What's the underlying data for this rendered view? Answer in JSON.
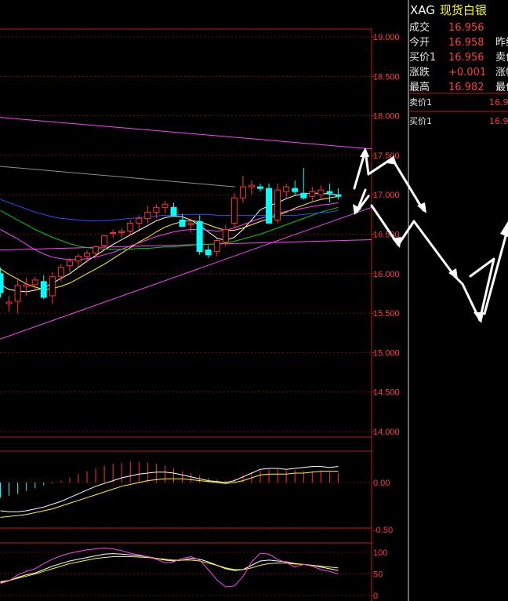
{
  "quote_panel": {
    "symbol": "XAG",
    "name": "现货白银",
    "rows": [
      {
        "label": "成交",
        "value": "16.956",
        "label2": ""
      },
      {
        "label": "今开",
        "value": "16.958",
        "label2": "昨结"
      },
      {
        "label": "买价1",
        "value": "16.956",
        "label2": "卖价"
      },
      {
        "label": "涨跌",
        "value": "+0.001",
        "label2": "涨幅"
      },
      {
        "label": "最高",
        "value": "16.982",
        "label2": "最低"
      }
    ],
    "orderbook": [
      {
        "label": "卖价1",
        "value": "16.9"
      },
      {
        "label": "买价1",
        "value": "16.9"
      }
    ]
  },
  "colors": {
    "up": "#ff3232",
    "down": "#00ffff",
    "frame": "#c01818",
    "grid": "#8c1010",
    "axis_text": "#ff4040",
    "ma5": "#ffffff",
    "ma10": "#ffff00",
    "ma20": "#ff40ff",
    "ma60": "#00d000",
    "ma120": "#3050ff",
    "trend": "#ff40ff",
    "forecast": "#ffffff"
  },
  "chart_data": [
    {
      "type": "candlestick",
      "ylim": [
        14.0,
        19.0
      ],
      "y_ticks": [
        "19.000",
        "18.500",
        "18.000",
        "17.500",
        "17.000",
        "16.500",
        "16.000",
        "15.500",
        "15.000",
        "14.500",
        "14.000"
      ],
      "candles": [
        {
          "o": 16.0,
          "h": 16.08,
          "l": 15.7,
          "c": 15.76
        },
        {
          "o": 15.62,
          "h": 15.72,
          "l": 15.52,
          "c": 15.64
        },
        {
          "o": 15.65,
          "h": 15.95,
          "l": 15.5,
          "c": 15.85
        },
        {
          "o": 15.84,
          "h": 15.95,
          "l": 15.72,
          "c": 15.86
        },
        {
          "o": 15.86,
          "h": 15.96,
          "l": 15.78,
          "c": 15.92
        },
        {
          "o": 15.9,
          "h": 15.98,
          "l": 15.68,
          "c": 15.7
        },
        {
          "o": 15.72,
          "h": 16.02,
          "l": 15.62,
          "c": 15.96
        },
        {
          "o": 15.96,
          "h": 16.12,
          "l": 15.9,
          "c": 16.08
        },
        {
          "o": 16.1,
          "h": 16.2,
          "l": 16.02,
          "c": 16.16
        },
        {
          "o": 16.16,
          "h": 16.25,
          "l": 16.08,
          "c": 16.22
        },
        {
          "o": 16.22,
          "h": 16.3,
          "l": 16.14,
          "c": 16.26
        },
        {
          "o": 16.26,
          "h": 16.36,
          "l": 16.2,
          "c": 16.34
        },
        {
          "o": 16.36,
          "h": 16.48,
          "l": 16.3,
          "c": 16.48
        },
        {
          "o": 16.52,
          "h": 16.56,
          "l": 16.45,
          "c": 16.52
        },
        {
          "o": 16.52,
          "h": 16.58,
          "l": 16.46,
          "c": 16.54
        },
        {
          "o": 16.54,
          "h": 16.68,
          "l": 16.48,
          "c": 16.64
        },
        {
          "o": 16.64,
          "h": 16.74,
          "l": 16.56,
          "c": 16.7
        },
        {
          "o": 16.7,
          "h": 16.86,
          "l": 16.64,
          "c": 16.78
        },
        {
          "o": 16.78,
          "h": 16.88,
          "l": 16.7,
          "c": 16.84
        },
        {
          "o": 16.84,
          "h": 16.92,
          "l": 16.76,
          "c": 16.88
        },
        {
          "o": 16.84,
          "h": 16.9,
          "l": 16.72,
          "c": 16.74
        },
        {
          "o": 16.68,
          "h": 16.76,
          "l": 16.6,
          "c": 16.6
        },
        {
          "o": 16.62,
          "h": 16.7,
          "l": 16.52,
          "c": 16.64
        },
        {
          "o": 16.66,
          "h": 16.74,
          "l": 16.24,
          "c": 16.28
        },
        {
          "o": 16.3,
          "h": 16.36,
          "l": 16.2,
          "c": 16.24
        },
        {
          "o": 16.28,
          "h": 16.44,
          "l": 16.22,
          "c": 16.42
        },
        {
          "o": 16.4,
          "h": 16.62,
          "l": 16.34,
          "c": 16.56
        },
        {
          "o": 16.64,
          "h": 17.02,
          "l": 16.58,
          "c": 16.96
        },
        {
          "o": 16.96,
          "h": 17.24,
          "l": 16.9,
          "c": 17.1
        },
        {
          "o": 17.1,
          "h": 17.18,
          "l": 17.0,
          "c": 17.12
        },
        {
          "o": 17.1,
          "h": 17.14,
          "l": 17.04,
          "c": 17.08
        },
        {
          "o": 17.08,
          "h": 17.14,
          "l": 16.64,
          "c": 16.64
        },
        {
          "o": 16.68,
          "h": 17.14,
          "l": 16.64,
          "c": 17.06
        },
        {
          "o": 17.04,
          "h": 17.14,
          "l": 16.96,
          "c": 17.1
        },
        {
          "o": 17.08,
          "h": 17.18,
          "l": 17.0,
          "c": 17.04
        },
        {
          "o": 17.02,
          "h": 17.34,
          "l": 16.94,
          "c": 16.96
        },
        {
          "o": 16.98,
          "h": 17.1,
          "l": 16.92,
          "c": 17.04
        },
        {
          "o": 17.0,
          "h": 17.12,
          "l": 16.94,
          "c": 17.06
        },
        {
          "o": 17.04,
          "h": 17.14,
          "l": 16.9,
          "c": 17.02
        },
        {
          "o": 17.0,
          "h": 17.08,
          "l": 16.94,
          "c": 16.98
        }
      ],
      "ma_series": [
        {
          "values": [
            15.86,
            15.8,
            15.78,
            15.77,
            15.79,
            15.82,
            15.88,
            15.94,
            16.0,
            16.08,
            16.16,
            16.23,
            16.3,
            16.37,
            16.43,
            16.49,
            16.55,
            16.61,
            16.67,
            16.71,
            16.73,
            16.72,
            16.68,
            16.61,
            16.53,
            16.45,
            16.42,
            16.46,
            16.56,
            16.68,
            16.81,
            16.86,
            16.9,
            16.95,
            16.99,
            17.01,
            17.02,
            17.02,
            17.01,
            17.0
          ]
        },
        {
          "values": [
            16.06,
            15.99,
            15.93,
            15.87,
            15.83,
            15.8,
            15.81,
            15.84,
            15.88,
            15.94,
            16.0,
            16.06,
            16.12,
            16.19,
            16.26,
            16.33,
            16.4,
            16.46,
            16.53,
            16.59,
            16.63,
            16.66,
            16.67,
            16.66,
            16.62,
            16.58,
            16.55,
            16.55,
            16.58,
            16.62,
            16.66,
            16.7,
            16.74,
            16.78,
            16.83,
            16.87,
            16.91,
            16.94,
            16.96,
            16.98
          ]
        },
        {
          "values": [
            16.56,
            16.5,
            16.44,
            16.37,
            16.3,
            16.25,
            16.21,
            16.19,
            16.18,
            16.18,
            16.19,
            16.21,
            16.24,
            16.27,
            16.31,
            16.35,
            16.39,
            16.43,
            16.47,
            16.5,
            16.53,
            16.55,
            16.56,
            16.56,
            16.55,
            16.54,
            16.55,
            16.58,
            16.62,
            16.66,
            16.7,
            16.73,
            16.76,
            16.79,
            16.81,
            16.83,
            16.85,
            16.87,
            16.88,
            16.9
          ]
        },
        {
          "values": [
            16.8,
            16.74,
            16.68,
            16.62,
            16.56,
            16.51,
            16.46,
            16.42,
            16.38,
            16.35,
            16.33,
            16.32,
            16.31,
            16.31,
            16.31,
            16.31,
            16.32,
            16.32,
            16.33,
            16.34,
            16.34,
            16.35,
            16.36,
            16.37,
            16.37,
            16.38,
            16.39,
            16.41,
            16.44,
            16.47,
            16.5,
            16.54,
            16.58,
            16.62,
            16.66,
            16.7,
            16.74,
            16.78,
            16.81,
            16.84
          ]
        },
        {
          "values": [
            16.94,
            16.9,
            16.86,
            16.82,
            16.78,
            16.75,
            16.72,
            16.7,
            16.69,
            16.68,
            16.67,
            16.67,
            16.67,
            16.68,
            16.69,
            16.7,
            16.71,
            16.72,
            16.73,
            16.74,
            16.74,
            16.75,
            16.75,
            16.75,
            16.75,
            16.74,
            16.74,
            16.74,
            16.74,
            16.74,
            16.74,
            16.74,
            16.74,
            16.74,
            16.74,
            16.75,
            16.76,
            16.77,
            16.78,
            16.8
          ]
        }
      ]
    },
    {
      "type": "bar",
      "ylim": [
        -0.5,
        0.5
      ],
      "y_ticks": [
        "0.00",
        "-0.50"
      ],
      "values": [
        -0.16,
        -0.14,
        -0.12,
        -0.09,
        -0.06,
        -0.03,
        -0.01,
        0.02,
        0.05,
        0.09,
        0.12,
        0.15,
        0.18,
        0.2,
        0.21,
        0.22,
        0.22,
        0.21,
        0.2,
        0.18,
        0.15,
        0.12,
        0.1,
        0.08,
        0.05,
        0.03,
        0.02,
        0.04,
        0.08,
        0.11,
        0.13,
        0.14,
        0.14,
        0.13,
        0.13,
        0.12,
        0.12,
        0.12,
        0.11,
        0.1
      ],
      "series": [
        {
          "values": [
            -0.3,
            -0.31,
            -0.31,
            -0.3,
            -0.28,
            -0.26,
            -0.23,
            -0.2,
            -0.16,
            -0.12,
            -0.08,
            -0.04,
            -0.01,
            0.02,
            0.05,
            0.07,
            0.09,
            0.1,
            0.11,
            0.11,
            0.1,
            0.08,
            0.06,
            0.04,
            0.02,
            0.01,
            0.0,
            0.02,
            0.06,
            0.1,
            0.14,
            0.15,
            0.15,
            0.14,
            0.15,
            0.16,
            0.17,
            0.17,
            0.16,
            0.17
          ]
        },
        {
          "values": [
            -0.37,
            -0.36,
            -0.35,
            -0.34,
            -0.32,
            -0.3,
            -0.28,
            -0.25,
            -0.22,
            -0.19,
            -0.16,
            -0.13,
            -0.1,
            -0.07,
            -0.04,
            -0.02,
            0.0,
            0.02,
            0.03,
            0.04,
            0.04,
            0.04,
            0.03,
            0.02,
            0.01,
            0.0,
            -0.01,
            0.0,
            0.02,
            0.05,
            0.08,
            0.09,
            0.09,
            0.09,
            0.1,
            0.1,
            0.11,
            0.12,
            0.12,
            0.12
          ]
        }
      ]
    },
    {
      "type": "line",
      "ylim": [
        0,
        100
      ],
      "y_ticks": [
        "100",
        "50",
        "0"
      ],
      "series": [
        {
          "values": [
            30,
            34,
            42,
            48,
            52,
            60,
            68,
            74,
            80,
            84,
            88,
            92,
            96,
            97,
            96,
            94,
            92,
            90,
            86,
            82,
            80,
            82,
            86,
            84,
            78,
            70,
            62,
            58,
            60,
            70,
            80,
            82,
            80,
            78,
            74,
            72,
            70,
            66,
            62,
            58
          ]
        },
        {
          "values": [
            32,
            35,
            40,
            45,
            50,
            56,
            62,
            68,
            74,
            78,
            82,
            86,
            88,
            90,
            90,
            90,
            89,
            88,
            86,
            84,
            82,
            82,
            82,
            80,
            75,
            70,
            64,
            60,
            60,
            64,
            70,
            74,
            75,
            75,
            73,
            72,
            70,
            68,
            66,
            64
          ]
        },
        {
          "values": [
            28,
            34,
            48,
            56,
            62,
            74,
            84,
            92,
            98,
            102,
            106,
            108,
            110,
            108,
            104,
            98,
            94,
            90,
            84,
            76,
            78,
            86,
            90,
            82,
            60,
            36,
            20,
            22,
            44,
            78,
            98,
            96,
            84,
            76,
            66,
            72,
            68,
            60,
            56,
            50
          ]
        }
      ]
    }
  ]
}
